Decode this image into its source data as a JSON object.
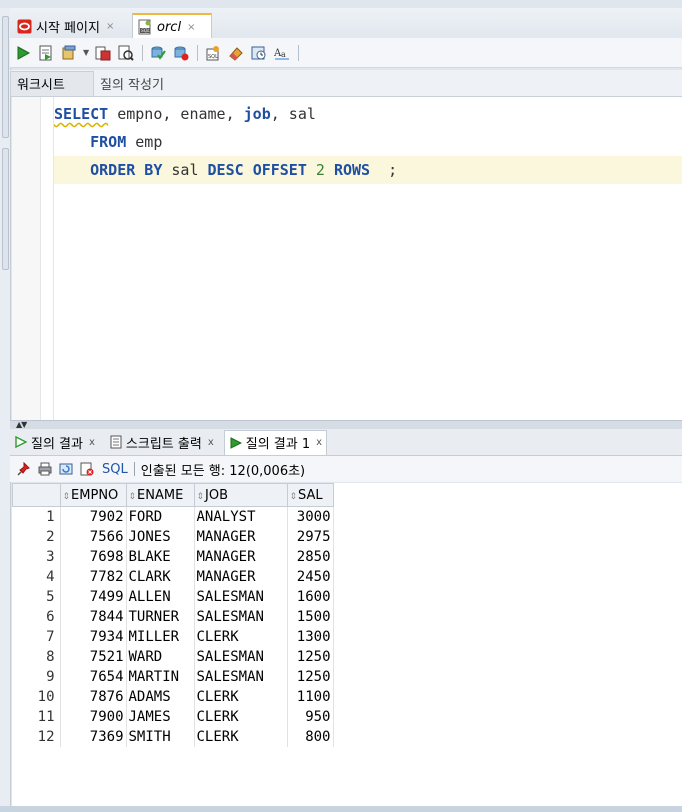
{
  "tabs": [
    {
      "label": "시작 페이지",
      "icon": "oracle-icon",
      "close": "×"
    },
    {
      "label": "orcl",
      "icon": "sql-worksheet-icon",
      "close": "×"
    }
  ],
  "subtabs": [
    "워크시트",
    "질의 작성기"
  ],
  "editor": {
    "lines": [
      [
        {
          "t": "SELECT",
          "c": "kw squig"
        },
        {
          "t": " empno, ename, ",
          "c": ""
        },
        {
          "t": "job",
          "c": "kw"
        },
        {
          "t": ", sal",
          "c": ""
        }
      ],
      [
        {
          "t": "    ",
          "c": ""
        },
        {
          "t": "FROM",
          "c": "kw"
        },
        {
          "t": " emp",
          "c": ""
        }
      ],
      [
        {
          "t": "    ",
          "c": ""
        },
        {
          "t": "ORDER BY",
          "c": "kw"
        },
        {
          "t": " sal ",
          "c": ""
        },
        {
          "t": "DESC",
          "c": "kw"
        },
        {
          "t": " ",
          "c": ""
        },
        {
          "t": "OFFSET",
          "c": "kw"
        },
        {
          "t": " ",
          "c": ""
        },
        {
          "t": "2",
          "c": "num"
        },
        {
          "t": " ",
          "c": ""
        },
        {
          "t": "ROWS",
          "c": "kw"
        },
        {
          "t": "  ;",
          "c": ""
        }
      ]
    ]
  },
  "result_tabs": [
    {
      "label": "질의 결과",
      "close": "x"
    },
    {
      "label": "스크립트 출력",
      "close": "x"
    },
    {
      "label": "질의 결과 1",
      "close": "x"
    }
  ],
  "result_toolbar": {
    "sql_label": "SQL",
    "status": "인출된 모든 행: 12(0,006초)"
  },
  "grid": {
    "columns": [
      "EMPNO",
      "ENAME",
      "JOB",
      "SAL"
    ],
    "rows": [
      [
        "1",
        "7902",
        "FORD",
        "ANALYST",
        "3000"
      ],
      [
        "2",
        "7566",
        "JONES",
        "MANAGER",
        "2975"
      ],
      [
        "3",
        "7698",
        "BLAKE",
        "MANAGER",
        "2850"
      ],
      [
        "4",
        "7782",
        "CLARK",
        "MANAGER",
        "2450"
      ],
      [
        "5",
        "7499",
        "ALLEN",
        "SALESMAN",
        "1600"
      ],
      [
        "6",
        "7844",
        "TURNER",
        "SALESMAN",
        "1500"
      ],
      [
        "7",
        "7934",
        "MILLER",
        "CLERK",
        "1300"
      ],
      [
        "8",
        "7521",
        "WARD",
        "SALESMAN",
        "1250"
      ],
      [
        "9",
        "7654",
        "MARTIN",
        "SALESMAN",
        "1250"
      ],
      [
        "10",
        "7876",
        "ADAMS",
        "CLERK",
        "1100"
      ],
      [
        "11",
        "7900",
        "JAMES",
        "CLERK",
        "950"
      ],
      [
        "12",
        "7369",
        "SMITH",
        "CLERK",
        "800"
      ]
    ]
  },
  "colors": {
    "keyword": "#1f4fa3",
    "number": "#3a7f3a",
    "highlight_line": "#fbf7dc"
  }
}
